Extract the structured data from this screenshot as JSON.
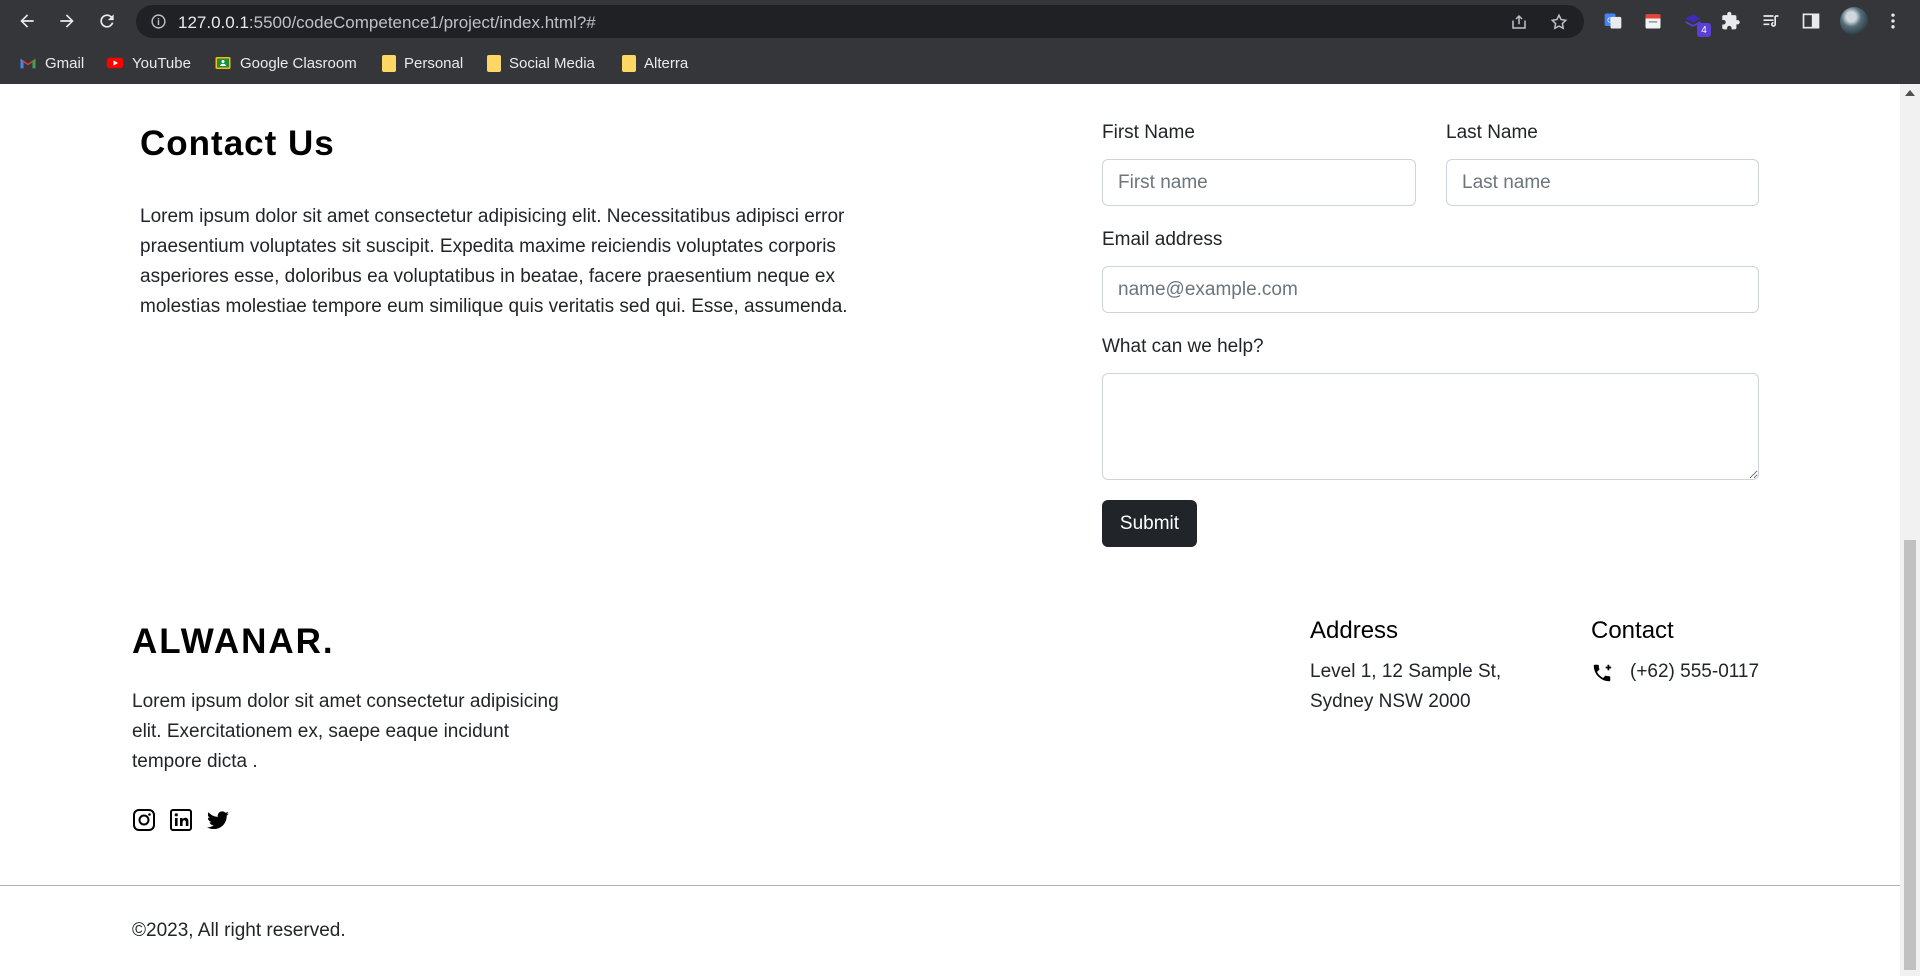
{
  "browser": {
    "url_host": "127.0.0.1",
    "url_rest": ":5500/codeCompetence1/project/index.html?#",
    "extension_badge": "4",
    "bookmarks": [
      {
        "label": "Gmail",
        "icon": "gmail-icon"
      },
      {
        "label": "YouTube",
        "icon": "youtube-icon"
      },
      {
        "label": "Google Clasroom",
        "icon": "classroom-icon"
      },
      {
        "label": "Personal",
        "icon": "folder-icon"
      },
      {
        "label": "Social Media",
        "icon": "folder-icon"
      },
      {
        "label": "Alterra",
        "icon": "folder-icon"
      }
    ]
  },
  "contact": {
    "title": "Contact Us",
    "text": "Lorem ipsum dolor sit amet consectetur adipisicing elit. Necessitatibus adipisci error praesentium voluptates sit suscipit. Expedita maxime reiciendis voluptates corporis asperiores esse, doloribus ea voluptatibus in beatae, facere praesentium neque ex molestias molestiae tempore eum similique quis veritatis sed qui. Esse, assumenda."
  },
  "form": {
    "first_name_label": "First Name",
    "first_name_placeholder": "First name",
    "last_name_label": "Last Name",
    "last_name_placeholder": "Last name",
    "email_label": "Email address",
    "email_placeholder": "name@example.com",
    "help_label": "What can we help?",
    "submit_label": "Submit"
  },
  "footer": {
    "brand": "ALWANAR.",
    "brand_text": "Lorem ipsum dolor sit amet consectetur adipisicing elit. Exercitationem ex, saepe eaque incidunt tempore dicta .",
    "social": [
      "instagram-icon",
      "linkedin-icon",
      "twitter-icon"
    ],
    "address_title": "Address",
    "address_line1": "Level 1, 12 Sample St,",
    "address_line2": "Sydney NSW 2000",
    "contact_title": "Contact",
    "phone": "(+62) 555-0117",
    "copyright": "©2023, All right reserved."
  },
  "colors": {
    "chrome_bg": "#35363a",
    "omnibox_bg": "#202124",
    "button_dark": "#212529"
  }
}
